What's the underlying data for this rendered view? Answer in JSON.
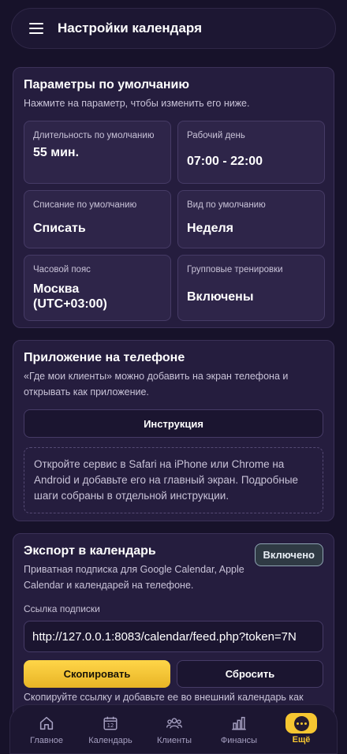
{
  "header": {
    "title": "Настройки календаря"
  },
  "defaults": {
    "title": "Параметры по умолчанию",
    "subtitle": "Нажмите на параметр, чтобы изменить его ниже.",
    "params": [
      {
        "label": "Длительность по умолчанию",
        "value": "55 мин."
      },
      {
        "label": "Рабочий день",
        "value": "07:00 - 22:00"
      },
      {
        "label": "Списание по умолчанию",
        "value": "Списать"
      },
      {
        "label": "Вид по умолчанию",
        "value": "Неделя"
      },
      {
        "label": "Часовой пояс",
        "value": "Москва (UTC+03:00)"
      },
      {
        "label": "Групповые тренировки",
        "value": "Включены"
      }
    ]
  },
  "app": {
    "title": "Приложение на телефоне",
    "subtitle": "«Где мои клиенты» можно добавить на экран телефона и открывать как приложение.",
    "instruction_button": "Инструкция",
    "hint": "Откройте сервис в Safari на iPhone или Chrome на Android и добавьте его на главный экран. Подробные шаги собраны в отдельной инструкции."
  },
  "export": {
    "title": "Экспорт в календарь",
    "badge": "Включено",
    "subtitle": "Приватная подписка для Google Calendar, Apple Calendar и календарей на телефоне.",
    "link_label": "Ссылка подписки",
    "link_value": "http://127.0.0.1:8083/calendar/feed.php?token=7N",
    "copy_button": "Скопировать",
    "reset_button": "Сбросить",
    "note": "Скопируйте ссылку и добавьте ее во внешний календарь как"
  },
  "nav": {
    "items": [
      {
        "label": "Главное",
        "icon": "home-icon"
      },
      {
        "label": "Календарь",
        "icon": "calendar-icon",
        "calendar_day": "12"
      },
      {
        "label": "Клиенты",
        "icon": "clients-icon"
      },
      {
        "label": "Финансы",
        "icon": "finance-icon"
      },
      {
        "label": "Ещё",
        "icon": "more-icon"
      }
    ],
    "active": "Ещё"
  },
  "colors": {
    "accent": "#f6c631",
    "background": "#17122a",
    "card": "#251d3e"
  }
}
